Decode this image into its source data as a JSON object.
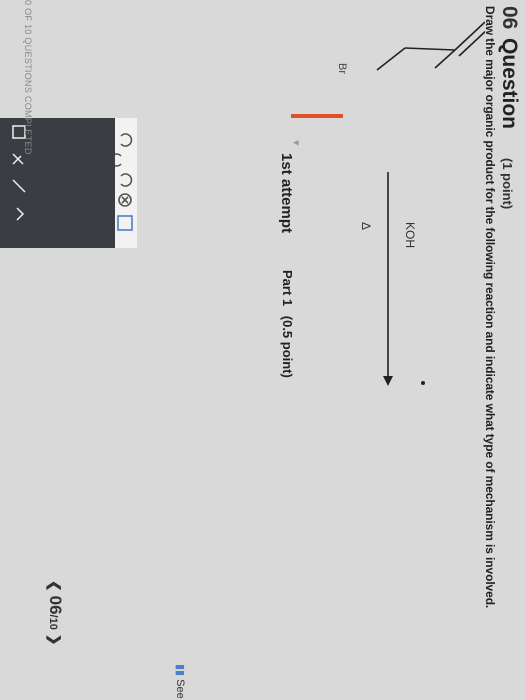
{
  "question": {
    "number": "06",
    "title": "Question",
    "points": "(1 point)",
    "prompt": "Draw the major organic product for the following reaction and indicate what type of mechanism is involved."
  },
  "reaction": {
    "substituent_label": "Br",
    "reagent": "KOH",
    "condition": "Δ"
  },
  "attempt": {
    "label": "1st attempt",
    "part_label": "Part 1",
    "part_points": "(0.5 point)"
  },
  "toolbar": {
    "undo_icon": "undo-icon",
    "redo_icon": "redo-icon",
    "refresh_icon": "refresh-icon",
    "clear_icon": "clear-icon",
    "grid_icon": "grid-icon",
    "select_icon": "select-icon",
    "eraser_icon": "eraser-icon",
    "bond_icon": "bond-icon",
    "ring_icon": "ring-icon"
  },
  "footer": {
    "completed": "0 OF 10 QUESTIONS COMPLETED",
    "pager_current": "06",
    "pager_total": "/10",
    "see_label": "See"
  }
}
